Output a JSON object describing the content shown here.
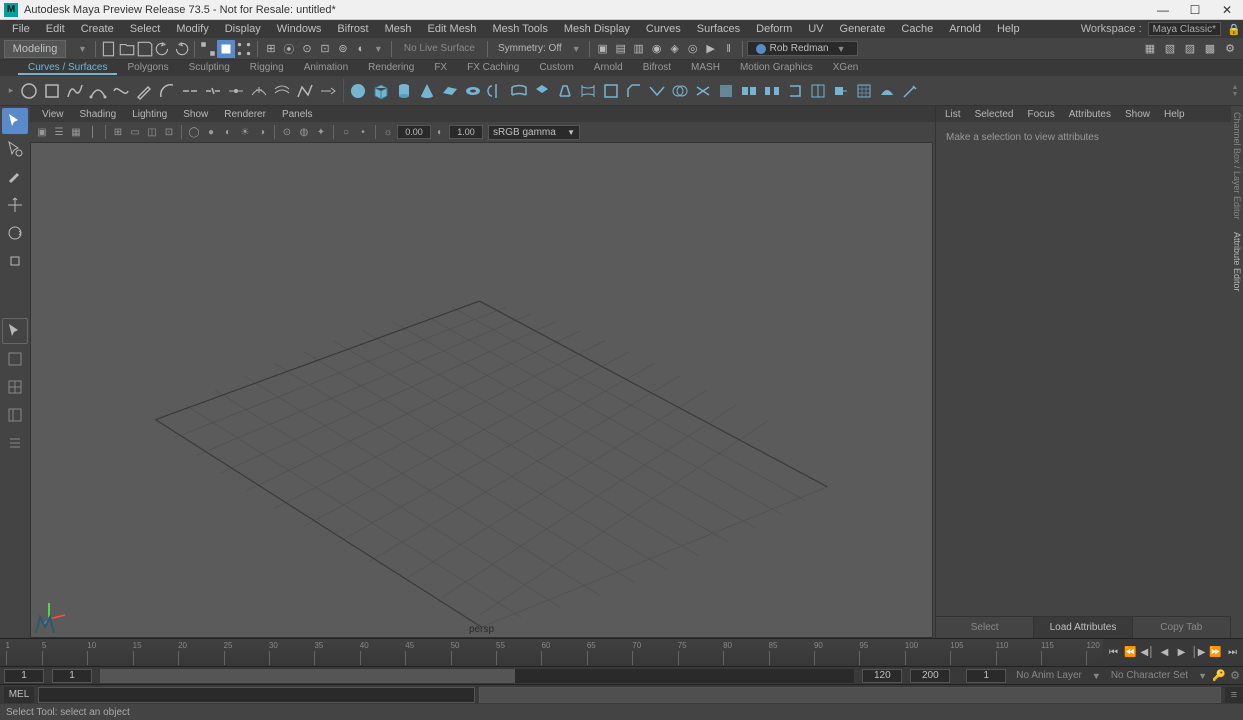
{
  "window": {
    "title": "Autodesk Maya Preview Release 73.5 - Not for Resale: untitled*",
    "app_letter": "M"
  },
  "menu_bar": {
    "items": [
      "File",
      "Edit",
      "Create",
      "Select",
      "Modify",
      "Display",
      "Windows",
      "Bifrost",
      "Mesh",
      "Edit Mesh",
      "Mesh Tools",
      "Mesh Display",
      "Curves",
      "Surfaces",
      "Deform",
      "UV",
      "Generate",
      "Cache",
      "Arnold",
      "Help"
    ],
    "workspace_label": "Workspace :",
    "workspace_value": "Maya Classic*"
  },
  "toolbar": {
    "shelf_selector": "Modeling",
    "live_surface": "No Live Surface",
    "symmetry": "Symmetry: Off",
    "user": "Rob Redman"
  },
  "shelf_tabs": [
    "Curves / Surfaces",
    "Polygons",
    "Sculpting",
    "Rigging",
    "Animation",
    "Rendering",
    "FX",
    "FX Caching",
    "Custom",
    "Arnold",
    "Bifrost",
    "MASH",
    "Motion Graphics",
    "XGen"
  ],
  "panel_menu": [
    "View",
    "Shading",
    "Lighting",
    "Show",
    "Renderer",
    "Panels"
  ],
  "panel_toolbar": {
    "val1": "0.00",
    "val2": "1.00",
    "gamma": "sRGB gamma"
  },
  "viewport": {
    "camera": "persp"
  },
  "attr_panel": {
    "menu": [
      "List",
      "Selected",
      "Focus",
      "Attributes",
      "Show",
      "Help"
    ],
    "placeholder": "Make a selection to view attributes",
    "buttons": [
      "Select",
      "Load Attributes",
      "Copy Tab"
    ]
  },
  "timeline": {
    "ticks": [
      1,
      5,
      10,
      15,
      20,
      25,
      30,
      35,
      40,
      45,
      50,
      55,
      60,
      65,
      70,
      75,
      80,
      85,
      90,
      95,
      100,
      105,
      110,
      115,
      120
    ]
  },
  "range": {
    "start": "1",
    "range_start": "1",
    "range_end": "120",
    "end": "200",
    "cur_frame": "1",
    "anim_layer": "No Anim Layer",
    "char_set": "No Character Set"
  },
  "cmd": {
    "label": "MEL"
  },
  "help": {
    "text": "Select Tool: select an object"
  },
  "side_tabs": [
    "Channel Box / Layer Editor",
    "Attribute Editor"
  ]
}
